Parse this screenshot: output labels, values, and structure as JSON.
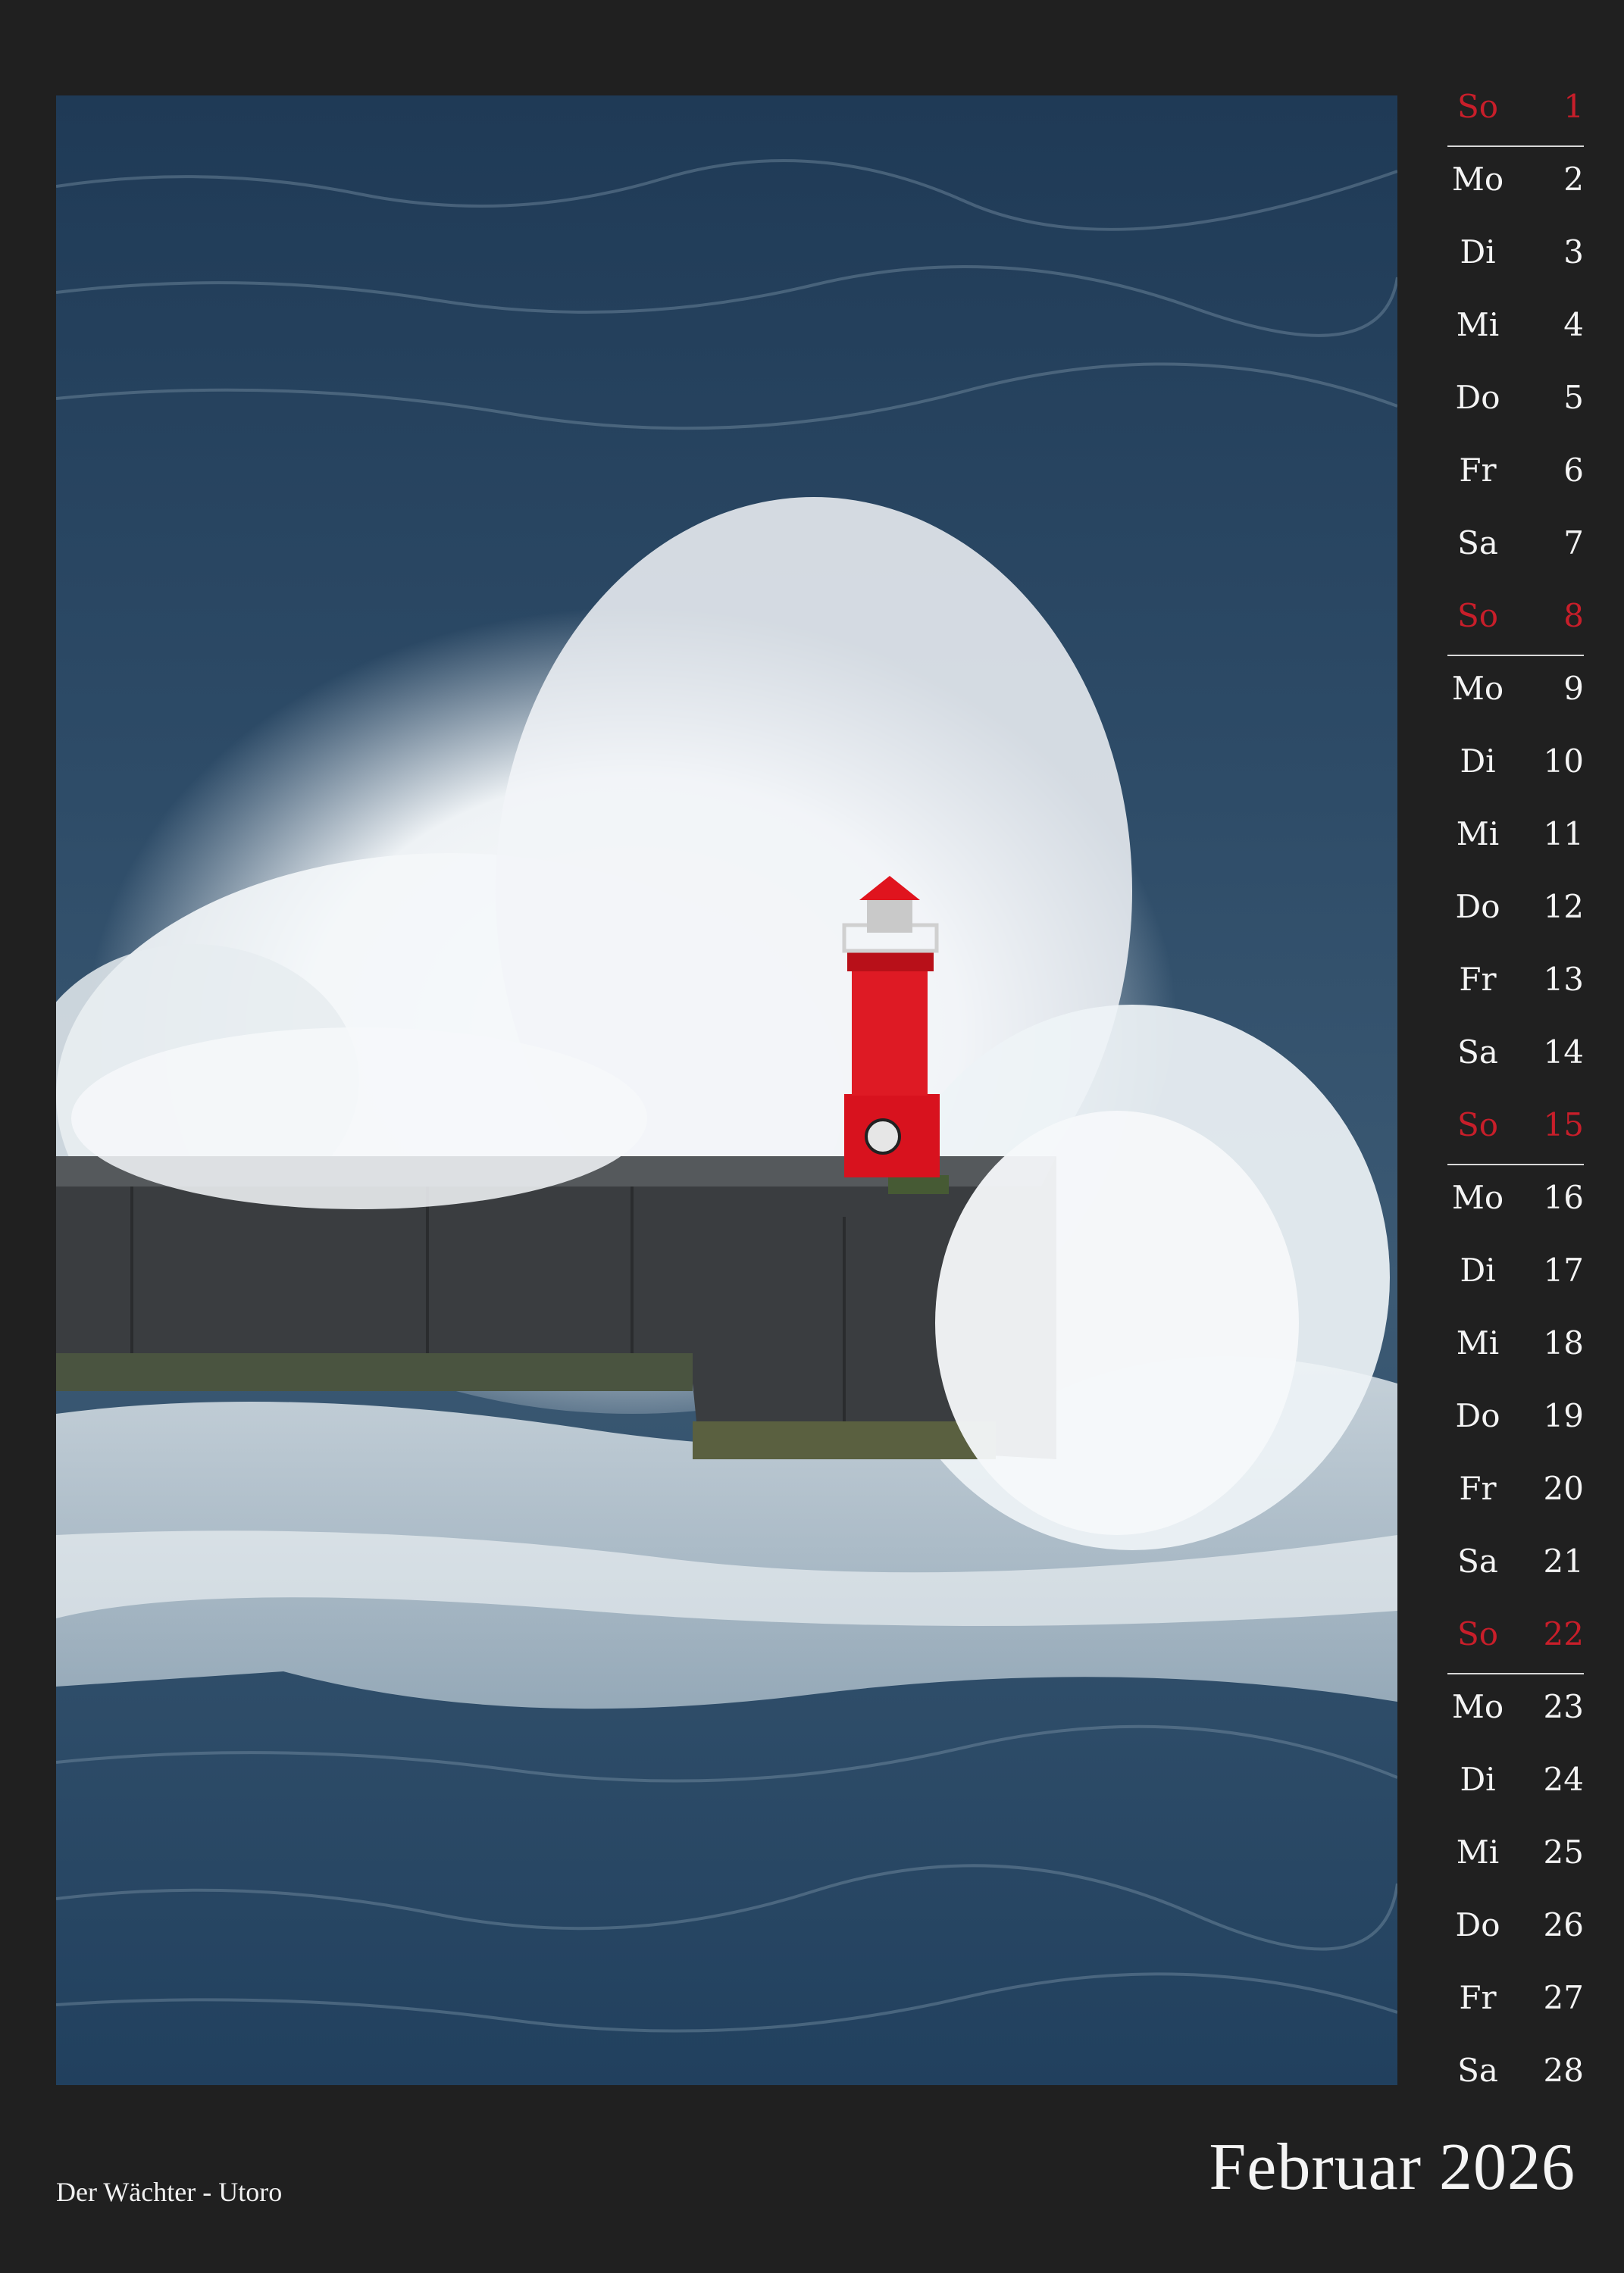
{
  "month_title": "Februar 2026",
  "caption": "Der Wächter - Utoro",
  "colors": {
    "background": "#202020",
    "sunday": "#c81e2a",
    "text": "#f4f4f4",
    "sea": "#2b4560",
    "lighthouse": "#d8121e"
  },
  "days": [
    {
      "day": "So",
      "num": "1",
      "sunday": true
    },
    {
      "day": "Mo",
      "num": "2"
    },
    {
      "day": "Di",
      "num": "3"
    },
    {
      "day": "Mi",
      "num": "4"
    },
    {
      "day": "Do",
      "num": "5"
    },
    {
      "day": "Fr",
      "num": "6"
    },
    {
      "day": "Sa",
      "num": "7"
    },
    {
      "day": "So",
      "num": "8",
      "sunday": true
    },
    {
      "day": "Mo",
      "num": "9"
    },
    {
      "day": "Di",
      "num": "10"
    },
    {
      "day": "Mi",
      "num": "11"
    },
    {
      "day": "Do",
      "num": "12"
    },
    {
      "day": "Fr",
      "num": "13"
    },
    {
      "day": "Sa",
      "num": "14"
    },
    {
      "day": "So",
      "num": "15",
      "sunday": true
    },
    {
      "day": "Mo",
      "num": "16"
    },
    {
      "day": "Di",
      "num": "17"
    },
    {
      "day": "Mi",
      "num": "18"
    },
    {
      "day": "Do",
      "num": "19"
    },
    {
      "day": "Fr",
      "num": "20"
    },
    {
      "day": "Sa",
      "num": "21"
    },
    {
      "day": "So",
      "num": "22",
      "sunday": true
    },
    {
      "day": "Mo",
      "num": "23"
    },
    {
      "day": "Di",
      "num": "24"
    },
    {
      "day": "Mi",
      "num": "25"
    },
    {
      "day": "Do",
      "num": "26"
    },
    {
      "day": "Fr",
      "num": "27"
    },
    {
      "day": "Sa",
      "num": "28"
    }
  ]
}
